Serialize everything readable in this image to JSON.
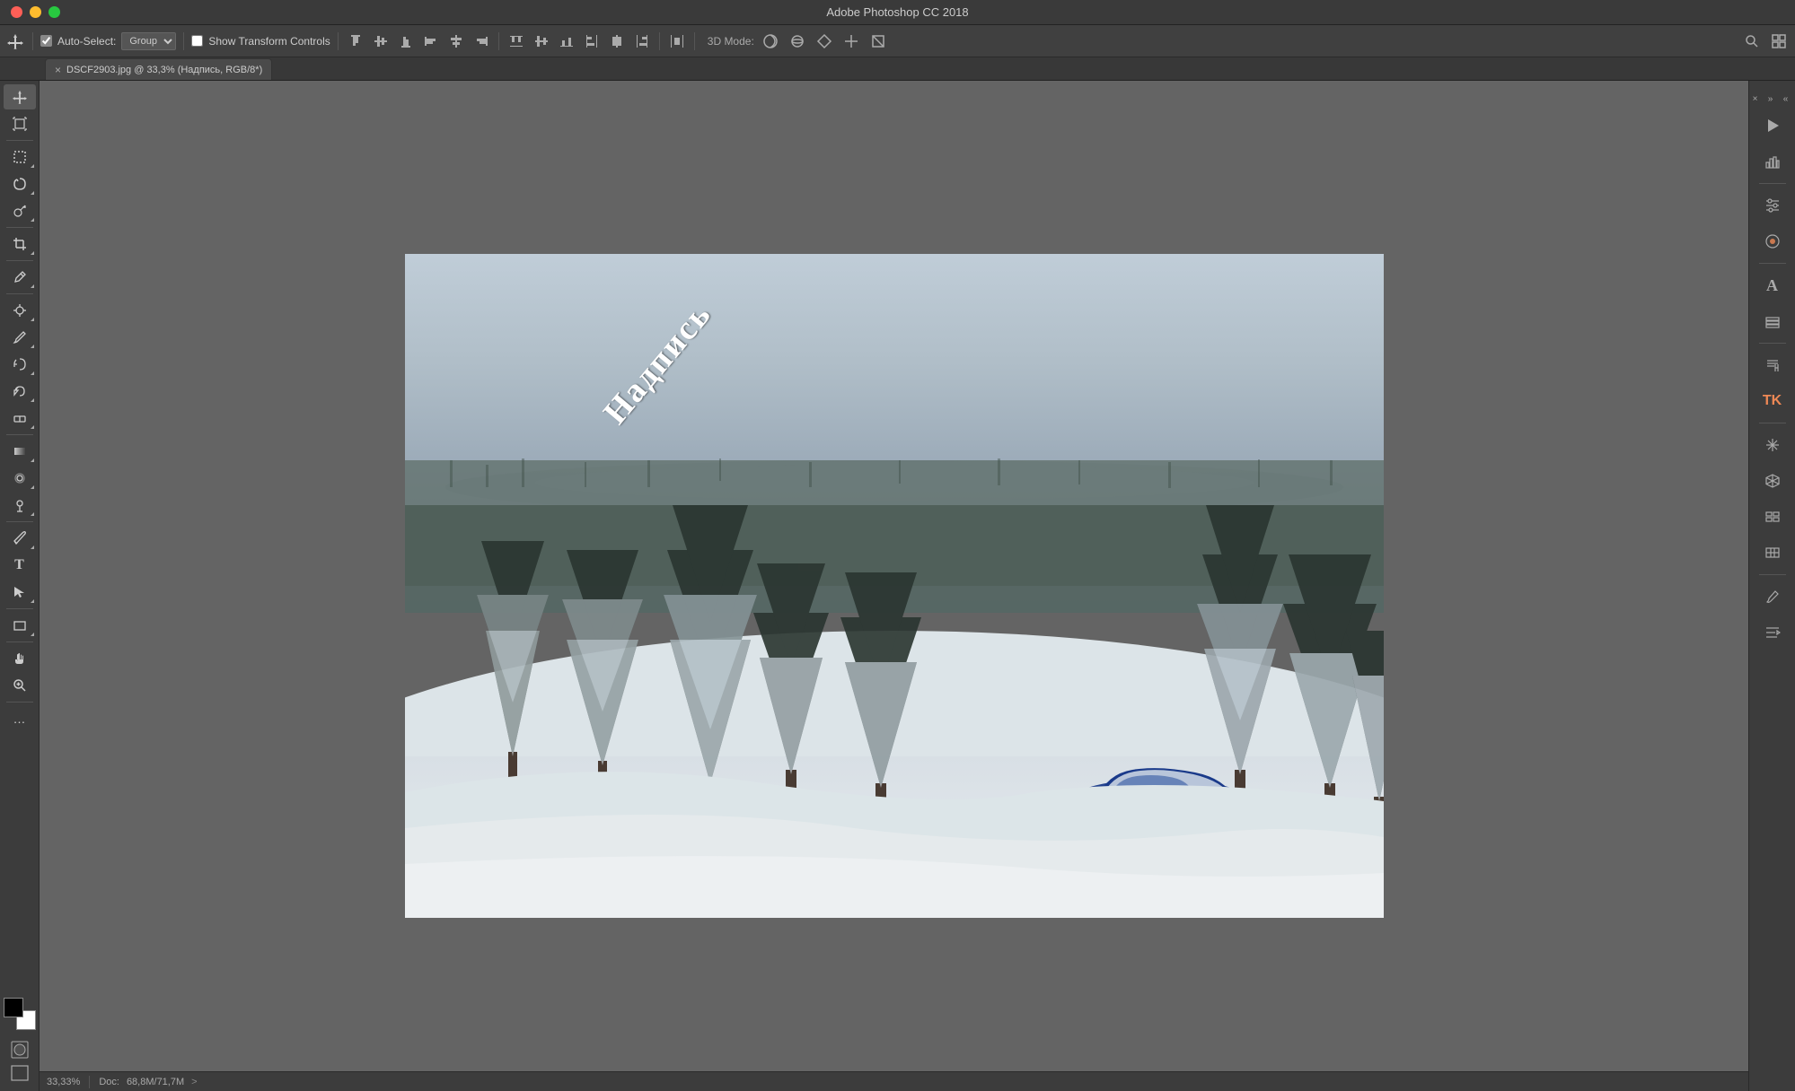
{
  "titleBar": {
    "title": "Adobe Photoshop CC 2018",
    "closeBtn": "×",
    "minBtn": "−",
    "maxBtn": "+"
  },
  "optionsBar": {
    "moveToolLabel": "Move",
    "autoSelectLabel": "Auto-Select:",
    "autoSelectChecked": true,
    "groupDropdown": "Group",
    "showTransformLabel": "Show Transform Controls",
    "showTransformChecked": false,
    "mode3dLabel": "3D Mode:",
    "alignButtons": [
      "⊤",
      "⊥",
      "⊣",
      "⊢",
      "⊞",
      "⊡",
      "⊟",
      "⊠",
      "⟺",
      "⟻",
      "⟼",
      "⧈"
    ],
    "searchIcon": "🔍",
    "workspaceIcon": "⊞"
  },
  "tabBar": {
    "tabs": [
      {
        "label": "DSCF2903.jpg @ 33,3% (Надпись, RGB/8*)",
        "modified": true,
        "closeable": true
      }
    ]
  },
  "leftToolbar": {
    "tools": [
      {
        "name": "move",
        "icon": "✛",
        "active": true
      },
      {
        "name": "artboard",
        "icon": "⊡"
      },
      {
        "name": "marquee",
        "icon": "▭",
        "hasMore": true
      },
      {
        "name": "lasso",
        "icon": "⌾",
        "hasMore": true
      },
      {
        "name": "quick-select",
        "icon": "⚡",
        "hasMore": true
      },
      {
        "name": "crop",
        "icon": "⊹"
      },
      {
        "name": "eyedropper",
        "icon": "✒",
        "hasMore": true
      },
      {
        "name": "healing",
        "icon": "⊕",
        "hasMore": true
      },
      {
        "name": "brush",
        "icon": "🖌",
        "hasMore": true
      },
      {
        "name": "clone",
        "icon": "✦",
        "hasMore": true
      },
      {
        "name": "history-brush",
        "icon": "↺",
        "hasMore": true
      },
      {
        "name": "eraser",
        "icon": "◻",
        "hasMore": true
      },
      {
        "name": "gradient",
        "icon": "◼",
        "hasMore": true
      },
      {
        "name": "blur",
        "icon": "◌",
        "hasMore": true
      },
      {
        "name": "dodge",
        "icon": "○",
        "hasMore": true
      },
      {
        "name": "pen",
        "icon": "✏",
        "hasMore": true
      },
      {
        "name": "type",
        "icon": "T"
      },
      {
        "name": "path-select",
        "icon": "↖",
        "hasMore": true
      },
      {
        "name": "shape",
        "icon": "▭",
        "hasMore": true
      },
      {
        "name": "hand",
        "icon": "✋"
      },
      {
        "name": "zoom",
        "icon": "🔍"
      },
      {
        "name": "extra",
        "icon": "…"
      }
    ],
    "fgColor": "#000000",
    "bgColor": "#ffffff"
  },
  "canvas": {
    "filename": "DSCF2903.jpg",
    "zoom": "33,3%",
    "layer": "Надпись",
    "colorMode": "RGB/8*",
    "overlayText": "Надпись"
  },
  "statusBar": {
    "zoom": "33,33%",
    "docLabel": "Doc:",
    "docSize": "68,8M/71,7M",
    "arrowLabel": ">"
  },
  "rightPanels": {
    "closeLabel": "×",
    "expandLabel": "»",
    "collapseLabel": "«",
    "icons": [
      {
        "name": "play",
        "icon": "▶"
      },
      {
        "name": "histogram",
        "icon": "📊"
      },
      {
        "name": "adjust",
        "icon": "≡"
      },
      {
        "name": "color-picker",
        "icon": "◎"
      },
      {
        "name": "type-panel",
        "icon": "A"
      },
      {
        "name": "layers",
        "icon": "▤"
      },
      {
        "name": "paragraph",
        "icon": "¶"
      },
      {
        "name": "tk-panel",
        "icon": "TK"
      },
      {
        "name": "astro",
        "icon": "✳"
      },
      {
        "name": "3d-panel",
        "icon": "⬡"
      },
      {
        "name": "timeline",
        "icon": "⊞"
      },
      {
        "name": "adjustments",
        "icon": "⊡"
      }
    ]
  }
}
